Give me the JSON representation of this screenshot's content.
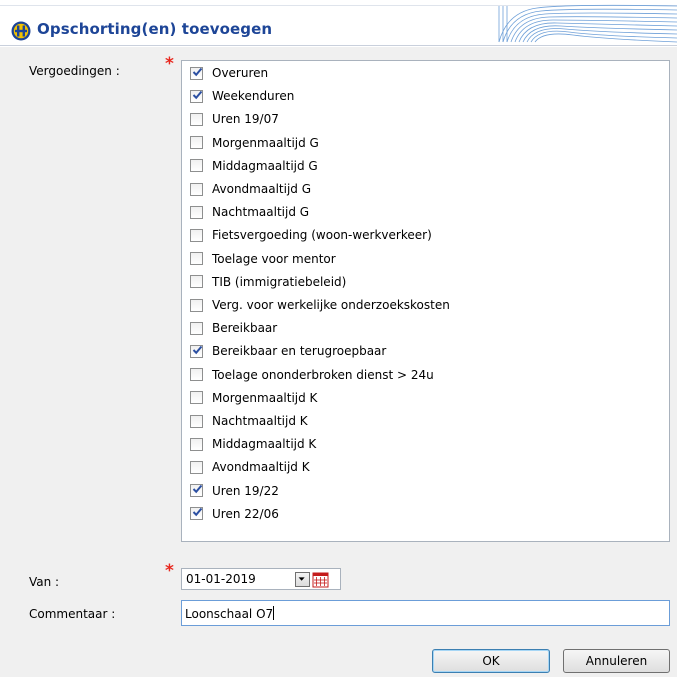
{
  "dialog": {
    "title": "Opschorting(en) toevoegen",
    "accent_color": "#1d4597",
    "required_color": "#e8281f"
  },
  "form": {
    "vergoedingen_label": "Vergoedingen :",
    "required_mark": "*",
    "items": [
      {
        "label": "Overuren",
        "checked": true
      },
      {
        "label": "Weekenduren",
        "checked": true
      },
      {
        "label": "Uren 19/07",
        "checked": false
      },
      {
        "label": "Morgenmaaltijd G",
        "checked": false
      },
      {
        "label": "Middagmaaltijd G",
        "checked": false
      },
      {
        "label": "Avondmaaltijd G",
        "checked": false
      },
      {
        "label": "Nachtmaaltijd G",
        "checked": false
      },
      {
        "label": "Fietsvergoeding (woon-werkverkeer)",
        "checked": false
      },
      {
        "label": "Toelage voor mentor",
        "checked": false
      },
      {
        "label": "TIB (immigratiebeleid)",
        "checked": false
      },
      {
        "label": "Verg. voor werkelijke onderzoekskosten",
        "checked": false
      },
      {
        "label": "Bereikbaar",
        "checked": false
      },
      {
        "label": "Bereikbaar en terugroepbaar",
        "checked": true
      },
      {
        "label": "Toelage ononderbroken dienst > 24u",
        "checked": false
      },
      {
        "label": "Morgenmaaltijd K",
        "checked": false
      },
      {
        "label": "Nachtmaaltijd K",
        "checked": false
      },
      {
        "label": "Middagmaaltijd K",
        "checked": false
      },
      {
        "label": "Avondmaaltijd K",
        "checked": false
      },
      {
        "label": "Uren 19/22",
        "checked": true
      },
      {
        "label": "Uren 22/06",
        "checked": true
      }
    ],
    "van_label": "Van :",
    "van_value": "01-01-2019",
    "commentaar_label": "Commentaar :",
    "commentaar_value": "Loonschaal O7"
  },
  "buttons": {
    "ok": "OK",
    "cancel": "Annuleren"
  },
  "icons": {
    "title": "app-logo-icon",
    "dropdown": "chevron-down-icon",
    "calendar": "calendar-icon",
    "check": "checkmark-icon"
  }
}
